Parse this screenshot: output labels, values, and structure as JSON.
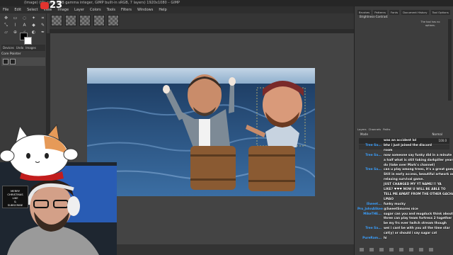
{
  "app": {
    "title": "(Image) (ID) color RGB gamma integer, GIMP built-in sRGB, 7 layers) 1920x1080 – GIMP",
    "menu": [
      "File",
      "Edit",
      "Select",
      "View",
      "Image",
      "Layer",
      "Colors",
      "Tools",
      "Filters",
      "Windows",
      "Help"
    ],
    "overlay_counter": "23"
  },
  "toolbox": {
    "dock_tabs": [
      "Devices",
      "Undo",
      "Images"
    ],
    "device_label": "Core Pointer"
  },
  "right_dock": {
    "tabs": [
      "Brushes",
      "Patterns",
      "Fonts",
      "Document History",
      "Tool Options"
    ],
    "subtitle": "Brightness-Contrast",
    "note": "The tool has no options.",
    "layer_tabs": [
      "Layers",
      "Channels",
      "Paths"
    ],
    "mode_label": "Mode",
    "mode_value": "Normal",
    "opacity_label": "100.0"
  },
  "chat": [
    {
      "name": "",
      "text": "was an accident lol"
    },
    {
      "name": "Tree Sa...",
      "text": "btw i just joined the discord"
    },
    {
      "name": "",
      "text": "room"
    },
    {
      "name": "Tree Sa...",
      "text": "now someone say funky did in a minute and"
    },
    {
      "name": "",
      "text": "a half what is still taking darkpiller years to"
    },
    {
      "name": "",
      "text": "do (take over Mark's channel)"
    },
    {
      "name": "Tree Sa...",
      "text": "can u play among trees, it's a great game."
    },
    {
      "name": "",
      "text": "Still in early access, beautiful artwork and"
    },
    {
      "name": "",
      "text": "relaxing survival game."
    },
    {
      "name": "",
      "text": "JUST CHANGED MY YT NAME!!! YA"
    },
    {
      "name": "",
      "text": "LIKE? ♥♥♥ NOW U WILL BE ABLE TO"
    },
    {
      "name": "",
      "text": "TELL ME APART FROM THE OTHER GACHA"
    },
    {
      "name": "",
      "text": "LMAO"
    },
    {
      "name": "iSweet...",
      "text": "funky mucky"
    },
    {
      "name": "Pro_JohnAlikee",
      "text": "@SweetSmores nice"
    },
    {
      "name": "MikeTHE...",
      "text": "sugar can you and mugduck think about us"
    },
    {
      "name": "",
      "text": "three can play team fortress 2 together itl"
    },
    {
      "name": "",
      "text": "be my frs ever twitch stream though"
    },
    {
      "name": "Tree Sa...",
      "text": "wei i cant be with you all the time star"
    },
    {
      "name": "",
      "text": "cat(y) or should i say sugar cat"
    },
    {
      "name": "PureRam...",
      "text": "hi"
    }
  ],
  "webcam": {
    "sign_lines": [
      "MERRY",
      "CHRISTMAS",
      "LIKE",
      "&",
      "SUBSCRIBE"
    ]
  },
  "colors": {
    "accent": "#3aa0ff",
    "badge": "#e3342f",
    "ocean": "#2f5b8a",
    "sky": "#a9c4dc"
  }
}
